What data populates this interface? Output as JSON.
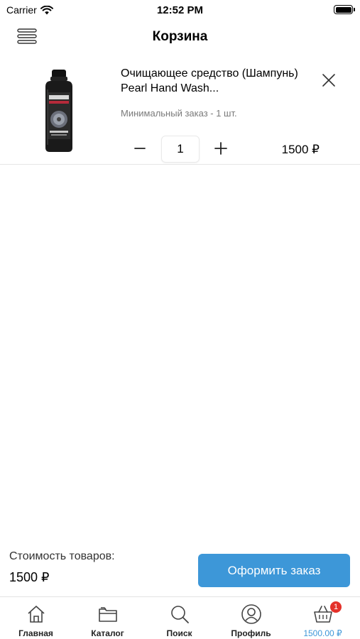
{
  "status_bar": {
    "carrier": "Carrier",
    "time": "12:52 PM"
  },
  "header": {
    "title": "Корзина",
    "menu_icon": "hamburger-icon"
  },
  "cart": {
    "items": [
      {
        "name": "Очищающее средство (Шампунь) Pearl Hand Wash...",
        "min_order": "Минимальный заказ - 1 шт.",
        "quantity": "1",
        "price": "1500 ₽",
        "image": "product-bottle-image"
      }
    ]
  },
  "summary": {
    "label": "Стоимость товаров:",
    "total": "1500 ₽",
    "checkout_label": "Оформить заказ"
  },
  "tab_bar": {
    "tabs": [
      {
        "label": "Главная",
        "icon": "home-icon"
      },
      {
        "label": "Каталог",
        "icon": "folder-icon"
      },
      {
        "label": "Поиск",
        "icon": "search-icon"
      },
      {
        "label": "Профиль",
        "icon": "profile-icon"
      },
      {
        "label": "1500.00 ₽",
        "icon": "basket-icon",
        "badge": "1"
      }
    ]
  },
  "colors": {
    "accent": "#3d97d8",
    "badge": "#e4312a",
    "muted_text": "#7a7a7a"
  }
}
